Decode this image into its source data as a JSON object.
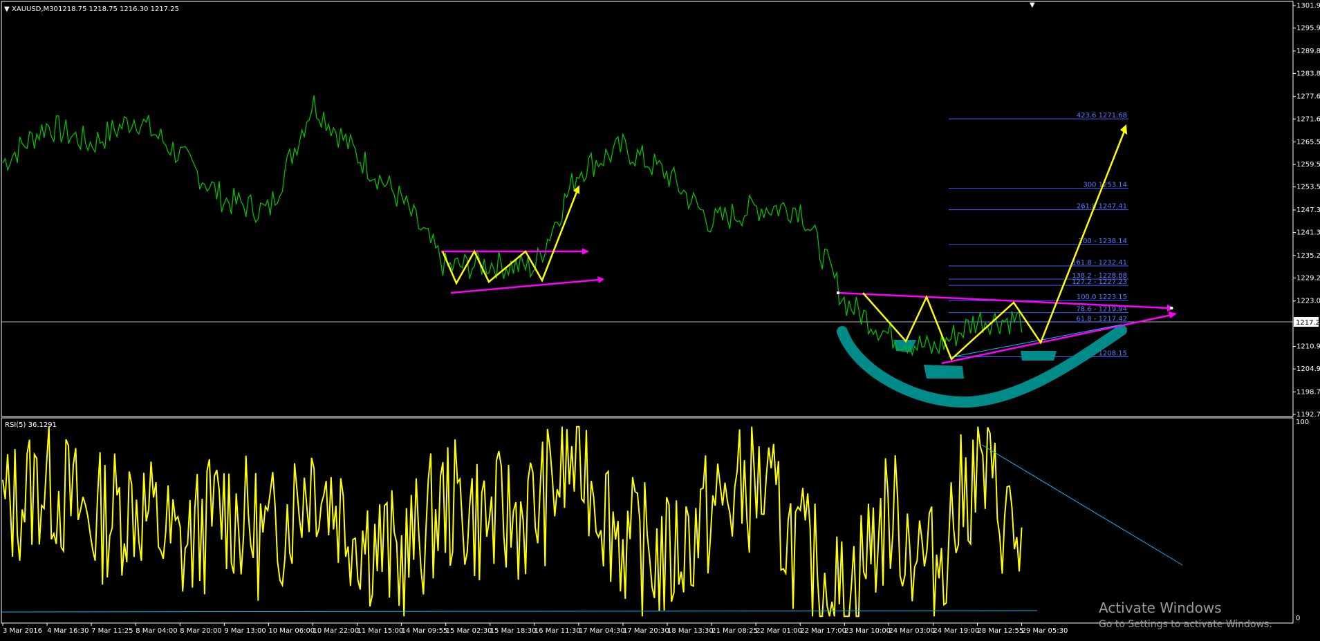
{
  "header": {
    "symbol_label": "XAUUSD,M30",
    "ohlc": "1218.75 1218.75 1216.30 1217.25",
    "rsi_label": "RSI(5) 36.1291"
  },
  "price_axis": {
    "ticks": [
      "1301.95",
      "1295.95",
      "1289.80",
      "1283.80",
      "1277.65",
      "1271.65",
      "1265.50",
      "1259.50",
      "1253.50",
      "1247.35",
      "1241.35",
      "1235.20",
      "1229.20",
      "1223.05",
      "1217.25",
      "1210.90",
      "1204.90",
      "1198.75",
      "1192.75"
    ],
    "current_price": "1217.25"
  },
  "rsi_axis": {
    "top": "100",
    "bottom": "0"
  },
  "time_axis": {
    "labels": [
      "3 Mar 2016",
      "4 Mar 16:30",
      "7 Mar 11:25",
      "8 Mar 04:00",
      "8 Mar 20:00",
      "9 Mar 13:00",
      "10 Mar 06:00",
      "10 Mar 22:00",
      "11 Mar 15:00",
      "14 Mar 09:55",
      "15 Mar 02:30",
      "15 Mar 18:30",
      "16 Mar 11:30",
      "17 Mar 04:30",
      "17 Mar 20:30",
      "18 Mar 13:30",
      "21 Mar 08:25",
      "22 Mar 01:00",
      "22 Mar 17:00",
      "23 Mar 10:00",
      "24 Mar 03:00",
      "24 Mar 19:00",
      "28 Mar 12:55",
      "29 Mar 05:30"
    ]
  },
  "fib_levels": [
    {
      "label": "423.6 1271.68",
      "price": 1271.68
    },
    {
      "label": "300 1253.14",
      "price": 1253.14
    },
    {
      "label": "261.8 1247.41",
      "price": 1247.41
    },
    {
      "label": "200 - 1238.14",
      "price": 1238.14
    },
    {
      "label": "161.8 - 1232.41",
      "price": 1232.41
    },
    {
      "label": "138.2 - 1228.88",
      "price": 1228.88
    },
    {
      "label": "127.2 - 1227.23",
      "price": 1227.23
    },
    {
      "label": "100.0 1223.15",
      "price": 1223.15
    },
    {
      "label": "78.6 - 1219.94",
      "price": 1219.94
    },
    {
      "label": "61.8 - 1217.42",
      "price": 1217.42
    },
    {
      "label": "0 1208.15",
      "price": 1208.15
    }
  ],
  "watermark": {
    "title": "Activate Windows",
    "subtitle": "Go to Settings to activate Windows."
  },
  "chart_data": [
    {
      "type": "line",
      "title": "XAUUSD,M30",
      "ylim": [
        1192.75,
        1301.95
      ],
      "series": [
        {
          "name": "XAUUSD",
          "x": [
            "3 Mar 2016",
            "4 Mar 16:30",
            "7 Mar 11:25",
            "8 Mar 04:00",
            "8 Mar 20:00",
            "9 Mar 13:00",
            "10 Mar 06:00",
            "10 Mar 22:00",
            "11 Mar 15:00",
            "14 Mar 09:55",
            "15 Mar 02:30",
            "15 Mar 18:30",
            "16 Mar 11:30",
            "17 Mar 04:30",
            "17 Mar 20:30",
            "18 Mar 13:30",
            "21 Mar 08:25",
            "22 Mar 01:00",
            "22 Mar 17:00",
            "23 Mar 10:00",
            "24 Mar 03:00",
            "24 Mar 19:00",
            "28 Mar 12:55",
            "29 Mar 05:30"
          ],
          "values": [
            1260,
            1270,
            1265,
            1272,
            1262,
            1250,
            1247,
            1276,
            1262,
            1250,
            1232,
            1233,
            1232,
            1258,
            1264,
            1257,
            1244,
            1248,
            1248,
            1223,
            1214,
            1210,
            1218,
            1218
          ]
        }
      ]
    },
    {
      "type": "line",
      "title": "RSI(5) 36.1291",
      "ylim": [
        0,
        100
      ],
      "series": [
        {
          "name": "RSI(5)",
          "x": [
            "3 Mar 2016",
            "4 Mar 16:30",
            "7 Mar 11:25",
            "8 Mar 04:00",
            "8 Mar 20:00",
            "9 Mar 13:00",
            "10 Mar 06:00",
            "10 Mar 22:00",
            "11 Mar 15:00",
            "14 Mar 09:55",
            "15 Mar 02:30",
            "15 Mar 18:30",
            "16 Mar 11:30",
            "17 Mar 04:30",
            "17 Mar 20:30",
            "18 Mar 13:30",
            "21 Mar 08:25",
            "22 Mar 01:00",
            "22 Mar 17:00",
            "23 Mar 10:00",
            "24 Mar 03:00",
            "24 Mar 19:00",
            "28 Mar 12:55",
            "29 Mar 05:30"
          ],
          "values": [
            55,
            72,
            50,
            60,
            35,
            58,
            40,
            75,
            45,
            30,
            60,
            50,
            55,
            85,
            40,
            30,
            55,
            70,
            35,
            10,
            55,
            25,
            80,
            36
          ]
        }
      ]
    }
  ],
  "colors": {
    "price_line": "#00c000",
    "rsi_line": "#ffff00",
    "pattern_arrow": "#ffff00",
    "trendline": "#ff00ff",
    "cup_highlight": "#008b8b",
    "fib": "#3d5bff",
    "rsi_trend": "#00bfff"
  }
}
